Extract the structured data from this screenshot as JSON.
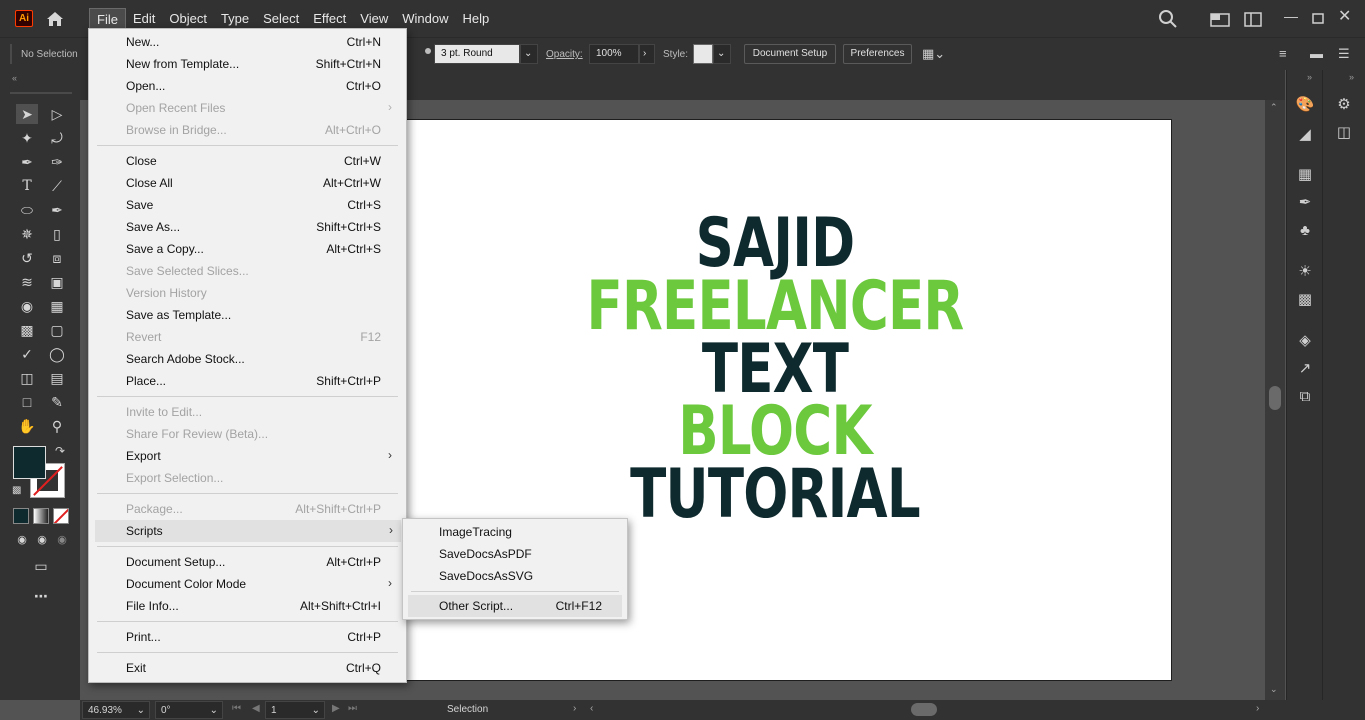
{
  "app": {
    "logo_text": "Ai"
  },
  "menubar": {
    "items": [
      "File",
      "Edit",
      "Object",
      "Type",
      "Select",
      "Effect",
      "View",
      "Window",
      "Help"
    ]
  },
  "controlbar": {
    "selection_label": "No Selection",
    "stroke_profile": "3 pt. Round",
    "opacity_label": "Opacity:",
    "opacity_value": "100%",
    "style_label": "Style:",
    "document_setup": "Document Setup",
    "preferences": "Preferences"
  },
  "artboard": {
    "lines": [
      {
        "text": "SAJID",
        "color": "#0f2a2e"
      },
      {
        "text": "FREELANCER",
        "color": "#6cc93e"
      },
      {
        "text": "TEXT",
        "color": "#0f2a2e"
      },
      {
        "text": "BLOCK",
        "color": "#6cc93e"
      },
      {
        "text": "TUTORIAL",
        "color": "#0f2a2e"
      }
    ]
  },
  "statusbar": {
    "zoom": "46.93%",
    "rotation": "0°",
    "artboard_number": "1",
    "tool_name": "Selection"
  },
  "file_menu": {
    "items": [
      {
        "label": "New...",
        "shortcut": "Ctrl+N",
        "enabled": true
      },
      {
        "label": "New from Template...",
        "shortcut": "Shift+Ctrl+N",
        "enabled": true
      },
      {
        "label": "Open...",
        "shortcut": "Ctrl+O",
        "enabled": true
      },
      {
        "label": "Open Recent Files",
        "shortcut": "",
        "enabled": false,
        "submenu": true
      },
      {
        "label": "Browse in Bridge...",
        "shortcut": "Alt+Ctrl+O",
        "enabled": false
      },
      {
        "label": "Close",
        "shortcut": "Ctrl+W",
        "enabled": true
      },
      {
        "label": "Close All",
        "shortcut": "Alt+Ctrl+W",
        "enabled": true
      },
      {
        "label": "Save",
        "shortcut": "Ctrl+S",
        "enabled": true
      },
      {
        "label": "Save As...",
        "shortcut": "Shift+Ctrl+S",
        "enabled": true
      },
      {
        "label": "Save a Copy...",
        "shortcut": "Alt+Ctrl+S",
        "enabled": true
      },
      {
        "label": "Save Selected Slices...",
        "shortcut": "",
        "enabled": false
      },
      {
        "label": "Version History",
        "shortcut": "",
        "enabled": false
      },
      {
        "label": "Save as Template...",
        "shortcut": "",
        "enabled": true
      },
      {
        "label": "Revert",
        "shortcut": "F12",
        "enabled": false
      },
      {
        "label": "Search Adobe Stock...",
        "shortcut": "",
        "enabled": true
      },
      {
        "label": "Place...",
        "shortcut": "Shift+Ctrl+P",
        "enabled": true
      },
      {
        "label": "Invite to Edit...",
        "shortcut": "",
        "enabled": false
      },
      {
        "label": "Share For Review (Beta)...",
        "shortcut": "",
        "enabled": false
      },
      {
        "label": "Export",
        "shortcut": "",
        "enabled": true,
        "submenu": true
      },
      {
        "label": "Export Selection...",
        "shortcut": "",
        "enabled": false
      },
      {
        "label": "Package...",
        "shortcut": "Alt+Shift+Ctrl+P",
        "enabled": false
      },
      {
        "label": "Scripts",
        "shortcut": "",
        "enabled": true,
        "submenu": true
      },
      {
        "label": "Document Setup...",
        "shortcut": "Alt+Ctrl+P",
        "enabled": true
      },
      {
        "label": "Document Color Mode",
        "shortcut": "",
        "enabled": true,
        "submenu": true
      },
      {
        "label": "File Info...",
        "shortcut": "Alt+Shift+Ctrl+I",
        "enabled": true
      },
      {
        "label": "Print...",
        "shortcut": "Ctrl+P",
        "enabled": true
      },
      {
        "label": "Exit",
        "shortcut": "Ctrl+Q",
        "enabled": true
      }
    ]
  },
  "scripts_submenu": {
    "items": [
      {
        "label": "ImageTracing",
        "shortcut": ""
      },
      {
        "label": "SaveDocsAsPDF",
        "shortcut": ""
      },
      {
        "label": "SaveDocsAsSVG",
        "shortcut": ""
      },
      {
        "label": "Other Script...",
        "shortcut": "Ctrl+F12"
      }
    ]
  },
  "colors": {
    "fill_swatch": "#0f2a2e",
    "accent_green": "#6cc93e"
  }
}
